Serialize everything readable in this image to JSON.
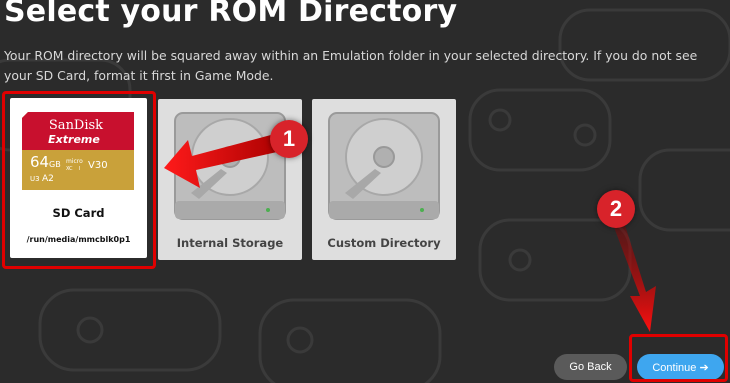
{
  "header": {
    "title": "Select your ROM Directory",
    "description": "Your ROM directory will be squared away within an Emulation folder in your selected directory. If you do not see your SD Card, format it first in Game Mode."
  },
  "options": [
    {
      "label": "SD Card",
      "path": "/run/media/mmcblk0p1",
      "card_brand": "SanDisk",
      "card_line": "Extreme",
      "capacity": "64",
      "capacity_unit": "GB",
      "card_type": "micro",
      "card_class": "V30",
      "card_speed": "A2",
      "card_uhs": "U3",
      "card_xc": "XC",
      "card_i": "I",
      "selected": true
    },
    {
      "label": "Internal Storage",
      "selected": false
    },
    {
      "label": "Custom Directory",
      "selected": false
    }
  ],
  "buttons": {
    "back": "Go Back",
    "continue": "Continue",
    "continue_arrow": "➔"
  },
  "annotations": {
    "step1": "1",
    "step2": "2",
    "color": "#d8232a"
  },
  "colors": {
    "accent": "#3ea6ef",
    "highlight": "#e00000",
    "background": "#2b2b2b"
  }
}
